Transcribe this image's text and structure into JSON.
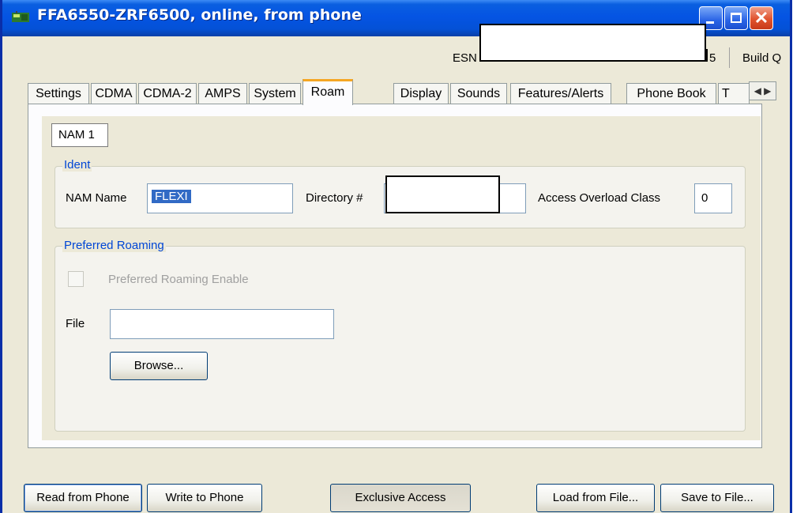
{
  "window": {
    "title": "FFA6550-ZRF6500, online, from phone",
    "icon": "phone-app-icon",
    "controls": [
      "minimize-icon",
      "maximize-icon",
      "close-icon"
    ],
    "close_glyph": "✕"
  },
  "info": {
    "esn_label": "ESN",
    "esn_tail": "5",
    "build_label": "Build Q"
  },
  "tabs": [
    {
      "label": "Settings"
    },
    {
      "label": "CDMA"
    },
    {
      "label": "CDMA-2"
    },
    {
      "label": "AMPS"
    },
    {
      "label": "System"
    },
    {
      "label": "Roam",
      "active": true
    },
    {
      "label": "Display"
    },
    {
      "label": "Sounds"
    },
    {
      "label": "Features/Alerts"
    },
    {
      "label": "Phone Book"
    },
    {
      "label": "T"
    }
  ],
  "tab_scroll": {
    "left": "◀",
    "right": "▶"
  },
  "nam_tab": "NAM 1",
  "ident": {
    "legend": "Ident",
    "nam_name_label": "NAM Name",
    "nam_name_value": "FLEXI",
    "directory_label": "Directory #",
    "access_overload_label": "Access Overload Class",
    "access_overload_value": "0"
  },
  "roaming": {
    "legend": "Preferred Roaming",
    "enable_label": "Preferred Roaming Enable",
    "enable_checked": false,
    "file_label": "File",
    "file_value": "",
    "browse_label": "Browse..."
  },
  "bottom_buttons": {
    "read": "Read from Phone",
    "write": "Write to Phone",
    "exclusive": "Exclusive Access",
    "load": "Load from File...",
    "save": "Save to File..."
  },
  "colors": {
    "titlebar": "#0554e3",
    "active_tab_accent": "#f5a623",
    "group_legend": "#0046d5",
    "selection": "#316ac5"
  }
}
